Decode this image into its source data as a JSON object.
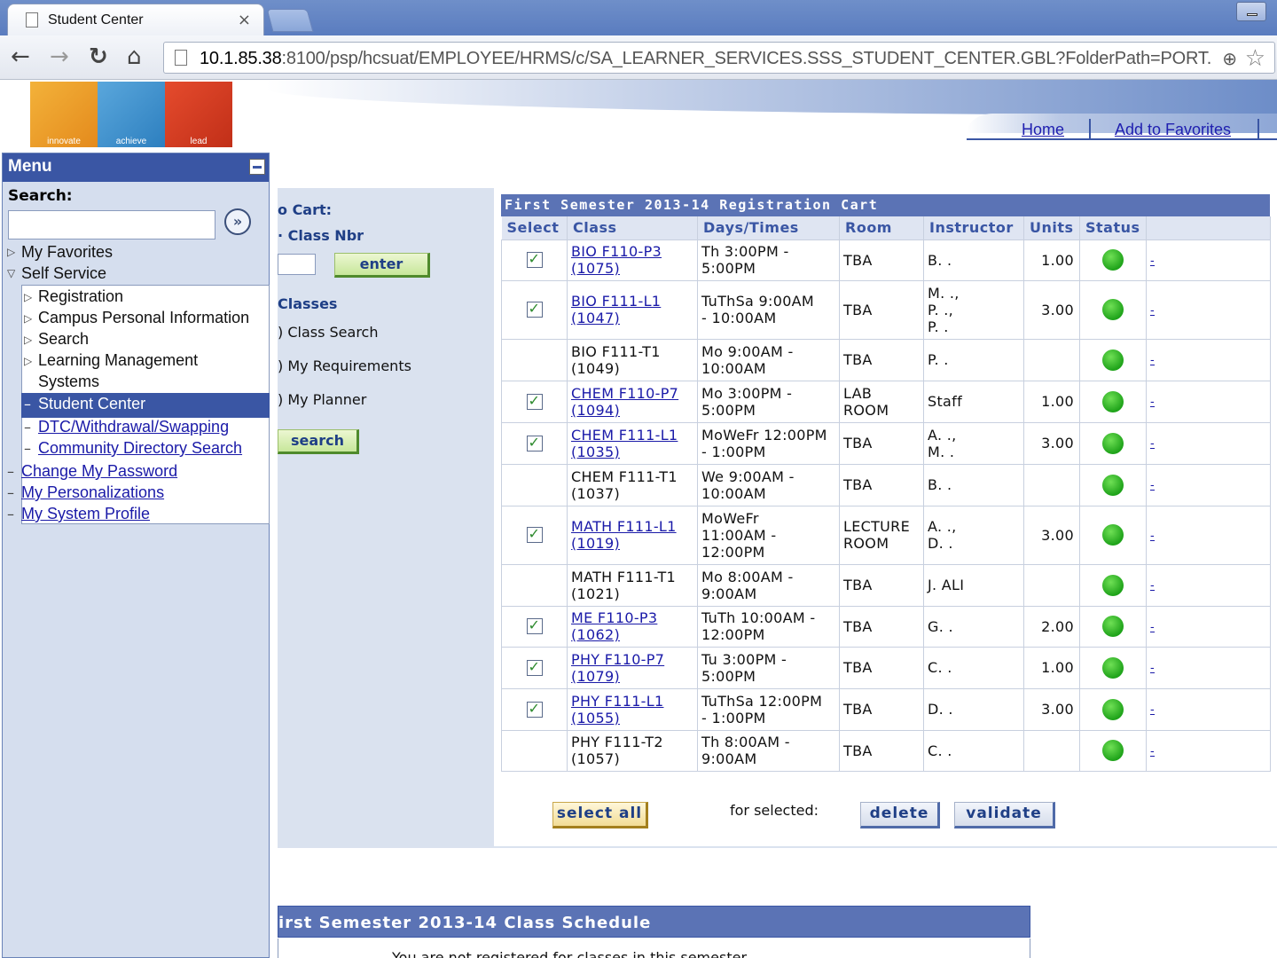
{
  "browser": {
    "tab_title": "Student Center",
    "tab_close": "×",
    "url_host": "10.1.85.38",
    "url_rest": ":8100/psp/hcsuat/EMPLOYEE/HRMS/c/SA_LEARNER_SERVICES.SSS_STUDENT_CENTER.GBL?FolderPath=PORT.",
    "back": "←",
    "forward": "→",
    "reload": "↻",
    "home": "⌂"
  },
  "logo": {
    "words": [
      "innovate",
      "achieve",
      "lead"
    ]
  },
  "header_links": {
    "home": "Home",
    "favorites": "Add to Favorites"
  },
  "menu": {
    "title": "Menu",
    "search_label": "Search:",
    "search_go": "»",
    "items": {
      "my_favorites": "My Favorites",
      "self_service": "Self Service",
      "registration": "Registration",
      "campus_personal": "Campus Personal Information",
      "search": "Search",
      "learning_mgmt_1": "Learning Management",
      "learning_mgmt_2": "Systems",
      "student_center": "Student Center",
      "dtc": "DTC/Withdrawal/Swapping",
      "community": "Community Directory Search",
      "change_pw": "Change My Password",
      "personalizations": "My Personalizations",
      "system_profile": "My System Profile"
    }
  },
  "left_pane": {
    "to_cart": "o Cart:",
    "class_nbr": "Class Nbr",
    "enter": "enter",
    "classes": "Classes",
    "class_search": ") Class Search",
    "my_requirements": ") My Requirements",
    "my_planner": ") My Planner",
    "search": "search"
  },
  "cart": {
    "title": "First Semester 2013-14 Registration Cart",
    "headers": [
      "Select",
      "Class",
      "Days/Times",
      "Room",
      "Instructor",
      "Units",
      "Status"
    ],
    "rows": [
      {
        "checked": true,
        "link": true,
        "class1": "BIO F110-P3",
        "class2": "(1075)",
        "time1": "Th 3:00PM -",
        "time2": "5:00PM",
        "time3": "",
        "room1": "TBA",
        "room2": "",
        "inst1": "B. .",
        "inst2": "",
        "inst3": "",
        "units": "1.00",
        "more": "-"
      },
      {
        "checked": true,
        "link": true,
        "class1": "BIO F111-L1",
        "class2": "(1047)",
        "time1": "TuThSa 9:00AM",
        "time2": "- 10:00AM",
        "time3": "",
        "room1": "TBA",
        "room2": "",
        "inst1": "M. .,",
        "inst2": "P. .,",
        "inst3": "P. .",
        "units": "3.00",
        "more": "-"
      },
      {
        "checked": false,
        "link": false,
        "class1": "BIO F111-T1",
        "class2": "(1049)",
        "time1": "Mo 9:00AM -",
        "time2": "10:00AM",
        "time3": "",
        "room1": "TBA",
        "room2": "",
        "inst1": "P. .",
        "inst2": "",
        "inst3": "",
        "units": "",
        "more": "-"
      },
      {
        "checked": true,
        "link": true,
        "class1": "CHEM F110-P7",
        "class2": "(1094)",
        "time1": "Mo 3:00PM -",
        "time2": "5:00PM",
        "time3": "",
        "room1": "LAB",
        "room2": "ROOM",
        "inst1": "Staff",
        "inst2": "",
        "inst3": "",
        "units": "1.00",
        "more": "-"
      },
      {
        "checked": true,
        "link": true,
        "class1": "CHEM F111-L1",
        "class2": "(1035)",
        "time1": "MoWeFr 12:00PM",
        "time2": "- 1:00PM",
        "time3": "",
        "room1": "TBA",
        "room2": "",
        "inst1": "A. .,",
        "inst2": "M. .",
        "inst3": "",
        "units": "3.00",
        "more": "-"
      },
      {
        "checked": false,
        "link": false,
        "class1": "CHEM F111-T1",
        "class2": "(1037)",
        "time1": "We 9:00AM -",
        "time2": "10:00AM",
        "time3": "",
        "room1": "TBA",
        "room2": "",
        "inst1": "B. .",
        "inst2": "",
        "inst3": "",
        "units": "",
        "more": "-"
      },
      {
        "checked": true,
        "link": true,
        "class1": "MATH F111-L1",
        "class2": "(1019)",
        "time1": "MoWeFr",
        "time2": "11:00AM -",
        "time3": "12:00PM",
        "room1": "LECTURE",
        "room2": "ROOM",
        "inst1": "A. .,",
        "inst2": "D. .",
        "inst3": "",
        "units": "3.00",
        "more": "-"
      },
      {
        "checked": false,
        "link": false,
        "class1": "MATH F111-T1",
        "class2": "(1021)",
        "time1": "Mo 8:00AM -",
        "time2": "9:00AM",
        "time3": "",
        "room1": "TBA",
        "room2": "",
        "inst1": "J. ALI",
        "inst2": "",
        "inst3": "",
        "units": "",
        "more": "-"
      },
      {
        "checked": true,
        "link": true,
        "class1": "ME F110-P3",
        "class2": "(1062)",
        "time1": "TuTh 10:00AM -",
        "time2": "12:00PM",
        "time3": "",
        "room1": "TBA",
        "room2": "",
        "inst1": "G. .",
        "inst2": "",
        "inst3": "",
        "units": "2.00",
        "more": "-"
      },
      {
        "checked": true,
        "link": true,
        "class1": "PHY F110-P7",
        "class2": "(1079)",
        "time1": "Tu 3:00PM -",
        "time2": "5:00PM",
        "time3": "",
        "room1": "TBA",
        "room2": "",
        "inst1": "C. .",
        "inst2": "",
        "inst3": "",
        "units": "1.00",
        "more": "-"
      },
      {
        "checked": true,
        "link": true,
        "class1": "PHY F111-L1",
        "class2": "(1055)",
        "time1": "TuThSa 12:00PM",
        "time2": "- 1:00PM",
        "time3": "",
        "room1": "TBA",
        "room2": "",
        "inst1": "D. .",
        "inst2": "",
        "inst3": "",
        "units": "3.00",
        "more": "-"
      },
      {
        "checked": false,
        "link": false,
        "class1": "PHY F111-T2",
        "class2": "(1057)",
        "time1": "Th 8:00AM -",
        "time2": "9:00AM",
        "time3": "",
        "room1": "TBA",
        "room2": "",
        "inst1": "C. .",
        "inst2": "",
        "inst3": "",
        "units": "",
        "more": "-"
      }
    ],
    "select_all": "select all",
    "for_selected": "for selected:",
    "delete": "delete",
    "validate": "validate"
  },
  "schedule": {
    "title": "irst Semester 2013-14 Class Schedule",
    "note": "You are not registered for classes in this semester."
  },
  "colors": {
    "header_blue": "#3a56a4",
    "grid_blue": "#5b73b5",
    "status_green": "#1fa31a"
  }
}
